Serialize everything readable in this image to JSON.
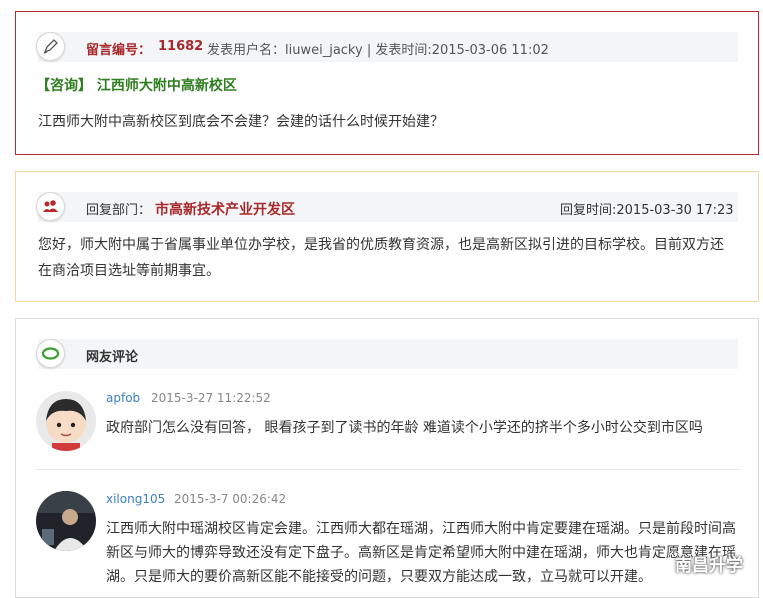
{
  "message": {
    "number_label": "留言编号：",
    "number": "11682",
    "author_info": "发表用户名：liuwei_jacky | 发表时间:2015-03-06 11:02",
    "title": "【咨询】 江西师大附中高新校区",
    "content": "江西师大附中高新校区到底会不会建？会建的话什么时候开始建？",
    "icon": "pen-icon"
  },
  "reply": {
    "dept_label": "回复部门：",
    "dept": "市高新技术产业开发区",
    "time": "回复时间:2015-03-30 17:23",
    "content_line1": "您好，师大附中属于省属事业单位办学校，是我省的优质教育资源，也是高新区拟引进的目标学校。目前双方还",
    "content_line2": "在商洽项目选址等前期事宜。",
    "icon": "people-icon"
  },
  "comments": {
    "title": "网友评论",
    "icon": "chat-bubble-icon",
    "items": [
      {
        "user": "apfob",
        "time": "2015-3-27 11:22:52",
        "text": "政府部门怎么没有回答， 眼看孩子到了读书的年龄 难道读个小学还的挤半个多小时公交到市区吗"
      },
      {
        "user": "xilong105",
        "time": "2015-3-7 00:26:42",
        "line1": "江西师大附中瑶湖校区肯定会建。江西师大都在瑶湖，江西师大附中肯定要建在瑶湖。只是前段时间高",
        "line2": "新区与师大的博弈导致还没有定下盘子。高新区是肯定希望师大附中建在瑶湖，师大也肯定愿意建在瑶",
        "line3": "湖。只是师大的要价高新区能不能接受的问题，只要双方能达成一致，立马就可以开建。"
      }
    ]
  },
  "watermark": "南昌升学"
}
